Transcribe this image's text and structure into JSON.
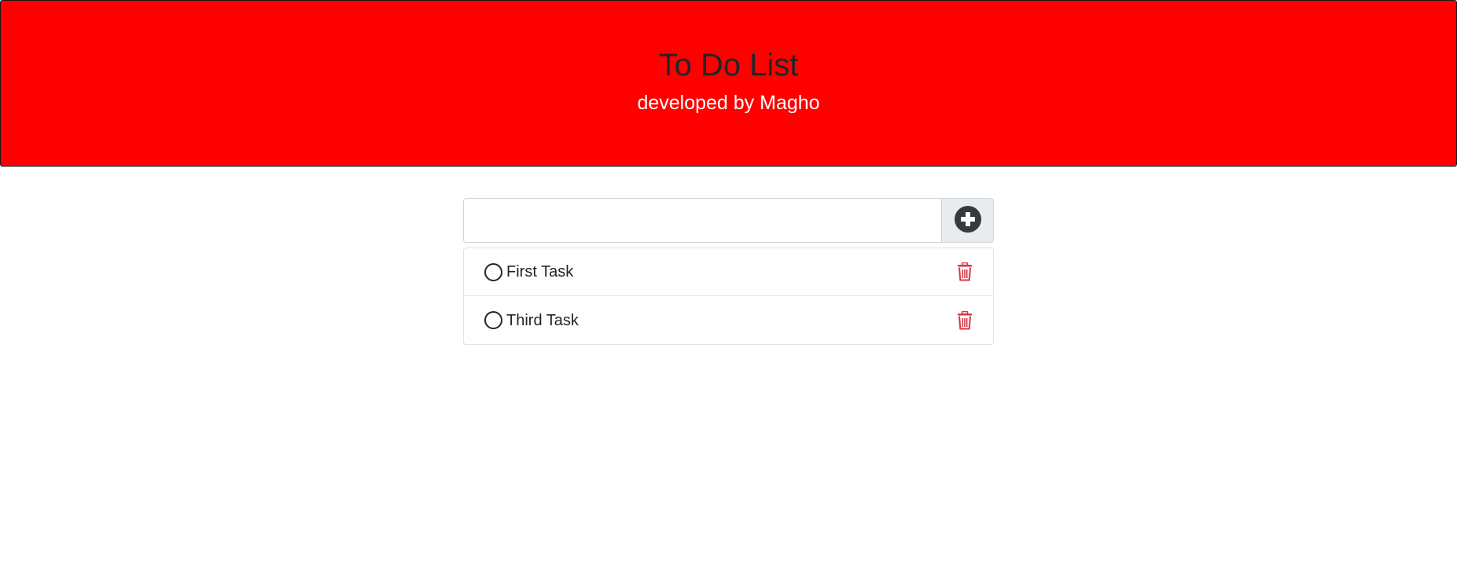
{
  "header": {
    "title": "To Do List",
    "subtitle": "developed by Magho",
    "background_color": "#ff0000"
  },
  "new_task": {
    "value": "",
    "placeholder": "",
    "add_icon": "plus-circle-icon"
  },
  "tasks": [
    {
      "label": "First Task",
      "completed": false,
      "check_icon": "circle-icon",
      "delete_icon": "trash-icon"
    },
    {
      "label": "Third Task",
      "completed": false,
      "check_icon": "circle-icon",
      "delete_icon": "trash-icon"
    }
  ],
  "colors": {
    "accent_delete": "#dc3545",
    "add_icon": "#343a40"
  }
}
